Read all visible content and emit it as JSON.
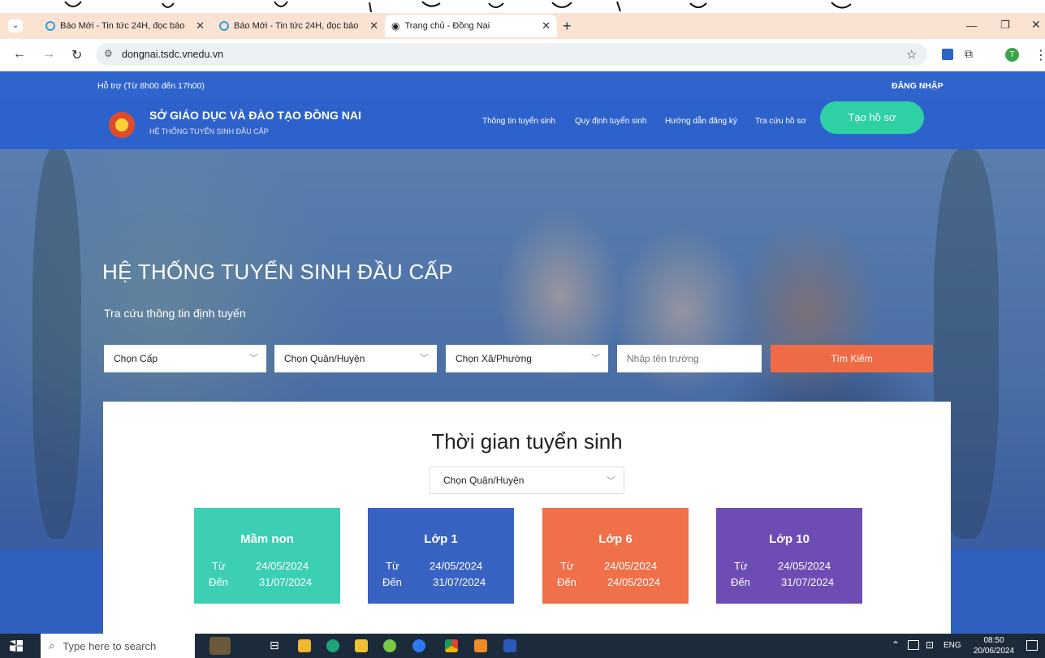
{
  "browser": {
    "tabs": [
      {
        "title": "Báo Mới - Tin tức 24H, đọc báo",
        "active": false
      },
      {
        "title": "Báo Mới - Tin tức 24H, đọc báo",
        "active": false
      },
      {
        "title": "Trang chủ - Đồng Nai",
        "active": true
      }
    ],
    "new_tab": "+",
    "url": "dongnai.tsdc.vnedu.vn",
    "profile_initial": "T"
  },
  "site": {
    "support": "Hỗ trợ (Từ 8h00 đến 17h00)",
    "login": "ĐĂNG NHẬP",
    "org_name": "SỞ GIÁO DỤC VÀ ĐÀO TẠO ĐỒNG NAI",
    "system_name": "HỆ THỐNG TUYỂN SINH ĐẦU CẤP",
    "nav": [
      "Thông tin tuyển sinh",
      "Quy định tuyển sinh",
      "Hướng dẫn đăng ký",
      "Tra cứu hồ sơ"
    ],
    "create_button": "Tạo hồ sơ",
    "hero_title": "HỆ THỐNG TUYỂN SINH ĐẦU CẤP",
    "hero_subtitle": "Tra cứu thông tin định tuyến",
    "search": {
      "level_select": "Chọn Cấp",
      "district_select": "Chọn Quận/Huyện",
      "ward_select": "Chọn Xã/Phường",
      "school_placeholder": "Nhập tên trường",
      "search_button": "Tìm Kiếm"
    },
    "schedule": {
      "title": "Thời gian tuyển sinh",
      "district_select": "Chọn Quận/Huyện",
      "from_label": "Từ",
      "to_label": "Đến",
      "boxes": [
        {
          "name": "Mầm non",
          "from": "24/05/2024",
          "to": "31/07/2024",
          "color": "#3ccfb4"
        },
        {
          "name": "Lớp 1",
          "from": "24/05/2024",
          "to": "31/07/2024",
          "color": "#3863c2"
        },
        {
          "name": "Lớp 6",
          "from": "24/05/2024",
          "to": "24/05/2024",
          "color": "#ef7049"
        },
        {
          "name": "Lớp 10",
          "from": "24/05/2024",
          "to": "31/07/2024",
          "color": "#6d4cb3"
        }
      ]
    }
  },
  "taskbar": {
    "search_placeholder": "Type here to search",
    "lang": "ENG",
    "time": "08:50",
    "date": "20/06/2024"
  }
}
